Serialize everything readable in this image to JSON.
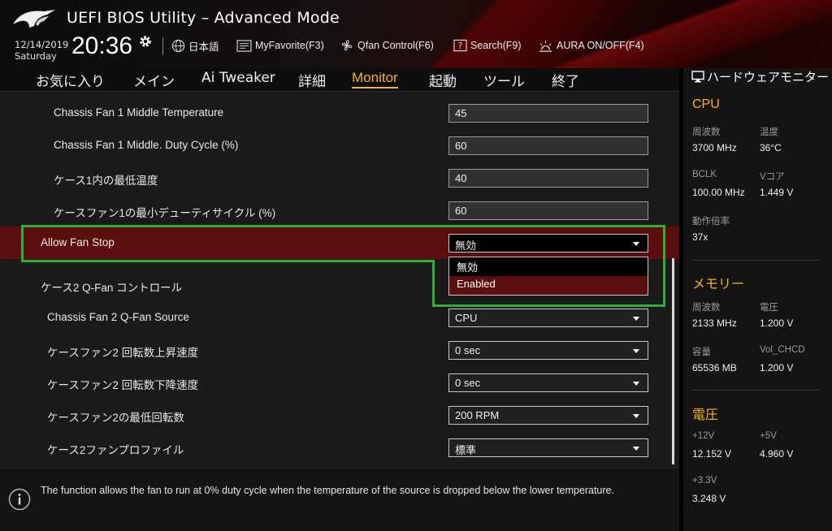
{
  "header": {
    "title": "UEFI BIOS Utility – Advanced Mode",
    "date": "12/14/2019",
    "day": "Saturday",
    "time": "20:36",
    "items": {
      "language": "日本語",
      "myfavorite": "MyFavorite(F3)",
      "qfan": "Qfan Control(F6)",
      "search": "Search(F9)",
      "aura": "AURA ON/OFF(F4)"
    }
  },
  "tabs": [
    "お気に入り",
    "メイン",
    "Ai Tweaker",
    "詳細",
    "Monitor",
    "起動",
    "ツール",
    "終了"
  ],
  "active_tab": "Monitor",
  "settings": [
    {
      "label": "Chassis Fan 1 Middle Temperature",
      "value": "45"
    },
    {
      "label": "Chassis Fan 1 Middle. Duty Cycle (%)",
      "value": "60"
    },
    {
      "label": "ケース1内の最低温度",
      "value": "40"
    },
    {
      "label": "ケースファン1の最小デューティサイクル (%)",
      "value": "60"
    },
    {
      "label": "Allow Fan Stop",
      "value": "無効"
    },
    {
      "label": "ケース2 Q-Fan コントロール",
      "value": ""
    },
    {
      "label": "Chassis Fan 2 Q-Fan Source",
      "value": "CPU"
    },
    {
      "label": "ケースファン2 回転数上昇速度",
      "value": "0 sec"
    },
    {
      "label": "ケースファン2 回転数下降速度",
      "value": "0 sec"
    },
    {
      "label": "ケースファン2の最低回転数",
      "value": "200 RPM"
    },
    {
      "label": "ケース2ファンプロファイル",
      "value": "標準"
    }
  ],
  "dropdown": {
    "options": [
      "無効",
      "Enabled"
    ],
    "highlighted": "Enabled"
  },
  "help_text": "The function allows the fan to run at 0% duty cycle when the temperature of the source is dropped below the lower temperature.",
  "hw_monitor": {
    "title": "ハードウェアモニター",
    "cpu": {
      "heading": "CPU",
      "freq_label": "周波数",
      "freq": "3700 MHz",
      "temp_label": "温度",
      "temp": "36°C",
      "bclk_label": "BCLK",
      "bclk": "100.00 MHz",
      "vcore_label": "Vコア",
      "vcore": "1.449 V",
      "ratio_label": "動作倍率",
      "ratio": "37x"
    },
    "memory": {
      "heading": "メモリー",
      "freq_label": "周波数",
      "freq": "2133 MHz",
      "volt_label": "電圧",
      "volt": "1.200 V",
      "cap_label": "容量",
      "cap": "65536 MB",
      "vol_chcd_label": "Vol_CHCD",
      "vol_chcd": "1.200 V"
    },
    "voltage": {
      "heading": "電圧",
      "v12_label": "+12V",
      "v12": "12.152 V",
      "v5_label": "+5V",
      "v5": "4.960 V",
      "v33_label": "+3.3V",
      "v33": "3.248 V"
    }
  },
  "colors": {
    "accent": "#f4b321",
    "selection": "#5a0e0e",
    "highlight_box": "#2fae3a"
  }
}
